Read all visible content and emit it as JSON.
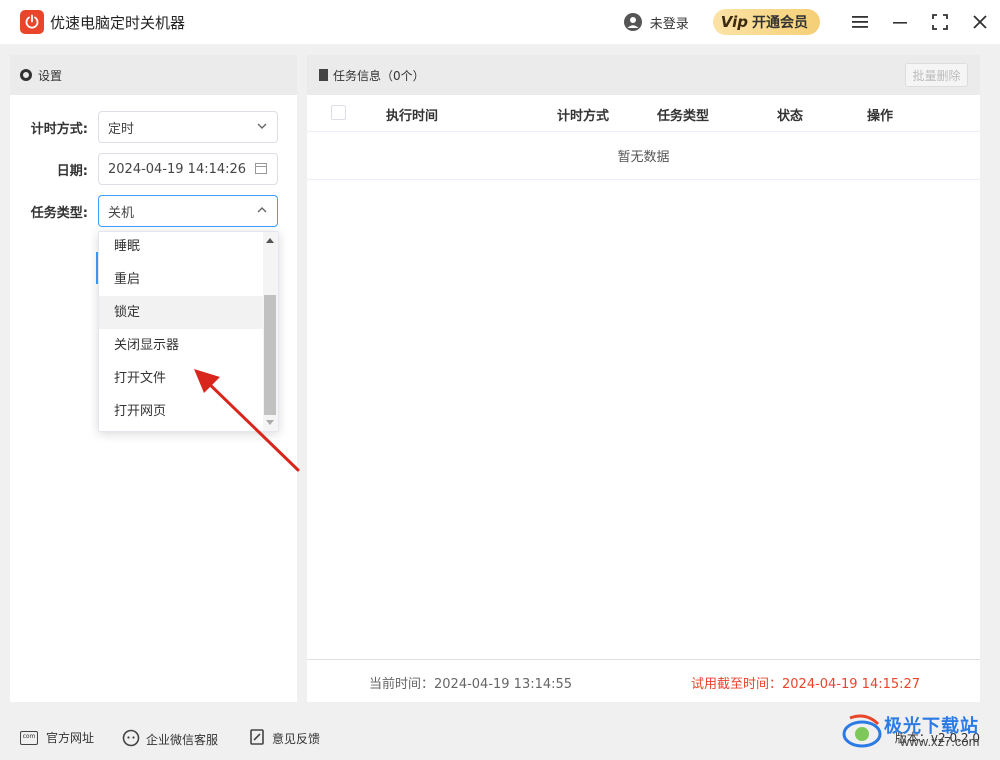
{
  "app": {
    "title": "优速电脑定时关机器"
  },
  "titlebar": {
    "login_label": "未登录",
    "vip_label": "开通会员",
    "vip_icon_text": "Vip"
  },
  "settings": {
    "header": "设置",
    "timing_label": "计时方式:",
    "timing_value": "定时",
    "date_label": "日期:",
    "date_value": "2024-04-19 14:14:26",
    "task_label": "任务类型:",
    "task_value": "关机"
  },
  "dropdown": {
    "options": [
      "睡眠",
      "重启",
      "锁定",
      "关闭显示器",
      "打开文件",
      "打开网页"
    ],
    "hovered": "锁定"
  },
  "tasks": {
    "header": "任务信息（0个）",
    "batch_delete": "批量删除",
    "columns": [
      "执行时间",
      "计时方式",
      "任务类型",
      "状态",
      "操作"
    ],
    "empty_text": "暂无数据",
    "current_time": "当前时间：2024-04-19 13:14:55",
    "trial_expiry": "试用截至时间：2024-04-19 14:15:27"
  },
  "footer": {
    "website": "官方网址",
    "wechat_service": "企业微信客服",
    "feedback": "意见反馈",
    "version": "版本：v2.0.2.0"
  },
  "watermark": {
    "brand": "极光下载站",
    "site": "www.xz7.com"
  },
  "colors": {
    "accent": "#409eff",
    "brand_red": "#e8452b",
    "vip_gold": "#f6cf76",
    "annotation_red": "#d9261c"
  }
}
